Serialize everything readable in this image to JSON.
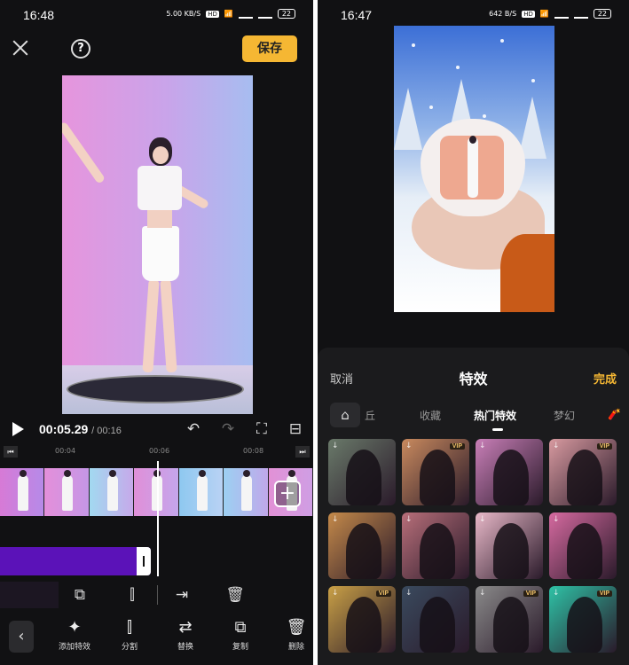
{
  "left": {
    "status": {
      "time": "16:48",
      "net": "5.00 KB/S",
      "hd": "HD",
      "battery": "22"
    },
    "save_label": "保存",
    "help_label": "?",
    "playback": {
      "current": "00:05.29",
      "duration": "/ 00:16"
    },
    "ruler": [
      "00:04",
      "00:06",
      "00:08"
    ],
    "toolbar": [
      {
        "label": "添加特效",
        "icon": "magic-sparkle-icon"
      },
      {
        "label": "分割",
        "icon": "split-icon"
      },
      {
        "label": "替换",
        "icon": "replace-icon"
      },
      {
        "label": "复制",
        "icon": "copy-icon"
      },
      {
        "label": "删除",
        "icon": "delete-icon"
      }
    ]
  },
  "right": {
    "status": {
      "time": "16:47",
      "net": "642 B/S",
      "hd": "HD",
      "battery": "22"
    },
    "sheet": {
      "cancel": "取消",
      "title": "特效",
      "done": "完成",
      "tabs": [
        "丘",
        "收藏",
        "热门特效",
        "梦幻"
      ],
      "active_tab": "热门特效"
    },
    "vip_label": "VIP",
    "grid": [
      {
        "bg": "#6a7a6a",
        "vip": false
      },
      {
        "bg": "#c98a5e",
        "vip": true
      },
      {
        "bg": "#c97fb8",
        "vip": false
      },
      {
        "bg": "#d89aa0",
        "vip": true
      },
      {
        "bg": "#c58a4a",
        "vip": false
      },
      {
        "bg": "#b86f7a",
        "vip": false
      },
      {
        "bg": "#e8b8c8",
        "vip": false
      },
      {
        "bg": "#d66aa0",
        "vip": false
      },
      {
        "bg": "#c9a046",
        "vip": true
      },
      {
        "bg": "#3a4a5e",
        "vip": false
      },
      {
        "bg": "#8a8a8a",
        "vip": true
      },
      {
        "bg": "#2ec2a6",
        "vip": true
      }
    ]
  },
  "colors": {
    "accent": "#f5b733",
    "effect_track": "#5b12b8"
  }
}
